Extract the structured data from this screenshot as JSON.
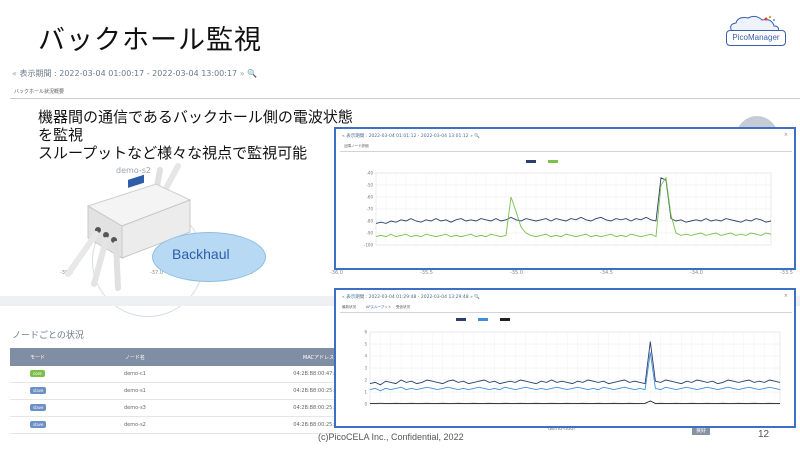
{
  "slide": {
    "title": "バックホール監視",
    "logo_text": "PicoManager",
    "description_lines": [
      "機器間の通信であるバックホール側の電波状態",
      "を監視",
      "スループットなど様々な視点で監視可能"
    ],
    "footer": "(c)PicoCELA Inc., Confidential, 2022",
    "page_number": "12"
  },
  "background_screen": {
    "period": "表示期間 : 2022-03-04 01:00:17 - 2022-03-04 13:00:17",
    "tab": "バックホール状況概要",
    "x_ticks": [
      "-38.0",
      "-37.0",
      "-36.5",
      "-36.0",
      "-35.5",
      "-35.0",
      "-34.5",
      "-34.0",
      "-33.5"
    ],
    "device_label": "demo-s2",
    "node_section_title": "ノードごとの状況",
    "table": {
      "headers": [
        "モード",
        "ノード名",
        "MACアドレス"
      ],
      "rows": [
        {
          "mode": "core",
          "name": "demo-c1",
          "mac": "04:2B:B8:00:47:"
        },
        {
          "mode": "slave",
          "name": "demo-s1",
          "mac": "04:2B:B8:00:25:"
        },
        {
          "mode": "slave",
          "name": "demo-s3",
          "mac": "04:2B:B8:00:25:"
        },
        {
          "mode": "slave",
          "name": "demo-s2",
          "mac": "04:2B:B8:00:25:"
        }
      ]
    },
    "bottom_cell": "demo-floor",
    "bottom_badge": "良好"
  },
  "backhaul_bubble": "Backhaul",
  "panel1": {
    "period": "表示期間 : 2022-03-04 01:01:12 - 2022-03-04 13:01:12",
    "tab": "近隣ノード詳細",
    "close": "×"
  },
  "panel2": {
    "period": "表示期間 : 2022-03-04 01:29:48 - 2022-03-04 13:29:48",
    "tabs": [
      "最新状況",
      "APスループット",
      "受信状況"
    ],
    "close": "×"
  },
  "colors": {
    "panel_border": "#3d6fc4",
    "series_navy": "#2a3f6b",
    "series_green": "#7cc04a",
    "series_blue": "#3f8fd8",
    "bubble": "#b7d9f3"
  },
  "chart_data": [
    {
      "type": "line",
      "title": "",
      "legend": "top-center",
      "ylim": [
        -100,
        -40
      ],
      "y_ticks": [
        -100,
        -90,
        -80,
        -70,
        -60,
        -50,
        -40
      ],
      "series": [
        {
          "color": "#2a3f6b",
          "values": [
            -82,
            -81,
            -82,
            -80,
            -81,
            -79,
            -80,
            -78,
            -80,
            -81,
            -79,
            -80,
            -78,
            -80,
            -79,
            -81,
            -79,
            -78,
            -80,
            -79,
            -80,
            -78,
            -79,
            -80,
            -78,
            -80,
            -79,
            -77,
            -79,
            -80,
            -78,
            -79,
            -80,
            -79,
            -78,
            -80,
            -78,
            -79,
            -80,
            -78,
            -79,
            -77,
            -79,
            -80,
            -78,
            -77,
            -79,
            -80,
            -78,
            -79,
            -78,
            -80,
            -78,
            -79,
            -77,
            -79,
            -80,
            -44,
            -46,
            -78,
            -80,
            -79,
            -81,
            -80,
            -79,
            -80,
            -78,
            -80,
            -79,
            -80,
            -78,
            -79,
            -80,
            -81,
            -79,
            -80,
            -78,
            -79,
            -81,
            -80
          ]
        },
        {
          "color": "#7cc04a",
          "values": [
            -93,
            -92,
            -93,
            -91,
            -93,
            -92,
            -91,
            -93,
            -92,
            -93,
            -91,
            -92,
            -93,
            -92,
            -91,
            -93,
            -92,
            -93,
            -92,
            -91,
            -93,
            -92,
            -93,
            -91,
            -92,
            -93,
            -92,
            -60,
            -72,
            -85,
            -90,
            -92,
            -93,
            -92,
            -91,
            -93,
            -92,
            -93,
            -91,
            -92,
            -93,
            -92,
            -91,
            -93,
            -92,
            -93,
            -92,
            -91,
            -93,
            -92,
            -93,
            -91,
            -92,
            -93,
            -92,
            -91,
            -93,
            -50,
            -44,
            -75,
            -90,
            -92,
            -91,
            -92,
            -91,
            -90,
            -92,
            -91,
            -90,
            -92,
            -91,
            -90,
            -92,
            -91,
            -92,
            -90,
            -91,
            -92,
            -90,
            -91
          ]
        }
      ]
    },
    {
      "type": "line",
      "title": "",
      "legend": "top-center",
      "ylim": [
        0,
        6
      ],
      "y_ticks": [
        0,
        1,
        2,
        3,
        4,
        5,
        6
      ],
      "series": [
        {
          "color": "#2a3f6b",
          "values": [
            1.7,
            1.8,
            1.6,
            1.9,
            1.8,
            1.7,
            2.0,
            1.8,
            1.9,
            1.7,
            1.8,
            2.0,
            1.9,
            1.8,
            1.7,
            1.9,
            2.0,
            1.8,
            1.9,
            1.7,
            1.8,
            1.9,
            2.0,
            1.8,
            1.9,
            1.7,
            1.8,
            1.9,
            1.8,
            2.0,
            1.9,
            1.8,
            1.7,
            1.9,
            1.8,
            2.0,
            1.8,
            1.9,
            1.8,
            1.7,
            1.9,
            1.8,
            2.0,
            1.9,
            1.8,
            1.9,
            1.7,
            1.8,
            1.9,
            2.0,
            1.8,
            1.9,
            1.8,
            1.7,
            5.2,
            1.9,
            1.8,
            2.0,
            1.9,
            1.8,
            1.7,
            1.9,
            1.8,
            2.0,
            1.9,
            1.8,
            1.9,
            1.7,
            1.8,
            2.0,
            1.9,
            1.8,
            1.9,
            2.0,
            1.8,
            1.9,
            1.8,
            2.0,
            1.9,
            1.8
          ]
        },
        {
          "color": "#3f8fd8",
          "values": [
            1.2,
            1.3,
            1.1,
            1.3,
            1.2,
            1.3,
            1.4,
            1.2,
            1.3,
            1.2,
            1.3,
            1.4,
            1.3,
            1.2,
            1.3,
            1.4,
            1.3,
            1.2,
            1.3,
            1.2,
            1.3,
            1.4,
            1.3,
            1.2,
            1.3,
            1.2,
            1.4,
            1.3,
            1.2,
            1.3,
            1.4,
            1.3,
            1.2,
            1.3,
            1.2,
            1.3,
            1.4,
            1.3,
            1.2,
            1.3,
            1.4,
            1.3,
            1.2,
            1.3,
            1.2,
            1.4,
            1.3,
            1.2,
            1.3,
            1.4,
            1.3,
            1.2,
            1.3,
            1.2,
            4.3,
            1.3,
            1.2,
            1.4,
            1.3,
            1.2,
            1.3,
            1.4,
            1.3,
            1.2,
            1.3,
            1.4,
            1.3,
            1.2,
            1.3,
            1.4,
            1.3,
            1.2,
            1.3,
            1.4,
            1.3,
            1.2,
            1.3,
            1.4,
            1.3,
            1.2
          ]
        },
        {
          "color": "#222222",
          "values": [
            0.05,
            0.05,
            0.06,
            0.05,
            0.05,
            0.06,
            0.05,
            0.05,
            0.06,
            0.05,
            0.05,
            0.06,
            0.05,
            0.05,
            0.06,
            0.05,
            0.05,
            0.06,
            0.05,
            0.05,
            0.06,
            0.05,
            0.05,
            0.06,
            0.05,
            0.05,
            0.06,
            0.05,
            0.05,
            0.06,
            0.05,
            0.05,
            0.06,
            0.05,
            0.05,
            0.06,
            0.05,
            0.05,
            0.06,
            0.05,
            0.05,
            0.06,
            0.05,
            0.05,
            0.06,
            0.05,
            0.05,
            0.06,
            0.05,
            0.05,
            0.06,
            0.05,
            0.05,
            0.06,
            0.25,
            0.05,
            0.06,
            0.05,
            0.05,
            0.06,
            0.05,
            0.05,
            0.06,
            0.05,
            0.05,
            0.06,
            0.05,
            0.05,
            0.06,
            0.05,
            0.05,
            0.06,
            0.05,
            0.05,
            0.06,
            0.05,
            0.05,
            0.06,
            0.05,
            0.05
          ]
        }
      ]
    }
  ]
}
